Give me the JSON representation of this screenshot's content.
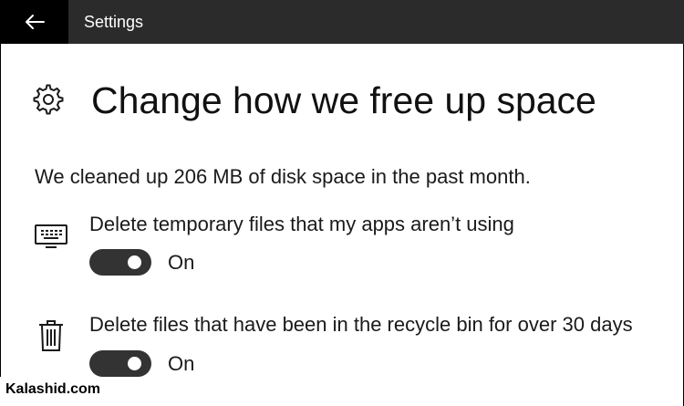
{
  "window": {
    "title": "Settings",
    "back_icon": "back-arrow-icon"
  },
  "header": {
    "icon": "gear-icon",
    "title": "Change how we free up space"
  },
  "summary": {
    "text": "We cleaned up 206 MB of disk space in the past month."
  },
  "settings": [
    {
      "icon": "keyboard-monitor-icon",
      "label": "Delete temporary files that my apps aren’t using",
      "toggle_on": true,
      "state_label": "On"
    },
    {
      "icon": "recycle-bin-icon",
      "label": "Delete files that have been in the recycle bin for over 30 days",
      "toggle_on": true,
      "state_label": "On"
    }
  ],
  "watermark": {
    "text": "Kalashid.com"
  },
  "colors": {
    "titlebar": "#2b2b2b",
    "back_button": "#000000",
    "toggle_on": "#333333",
    "text": "#1a1a1a"
  }
}
